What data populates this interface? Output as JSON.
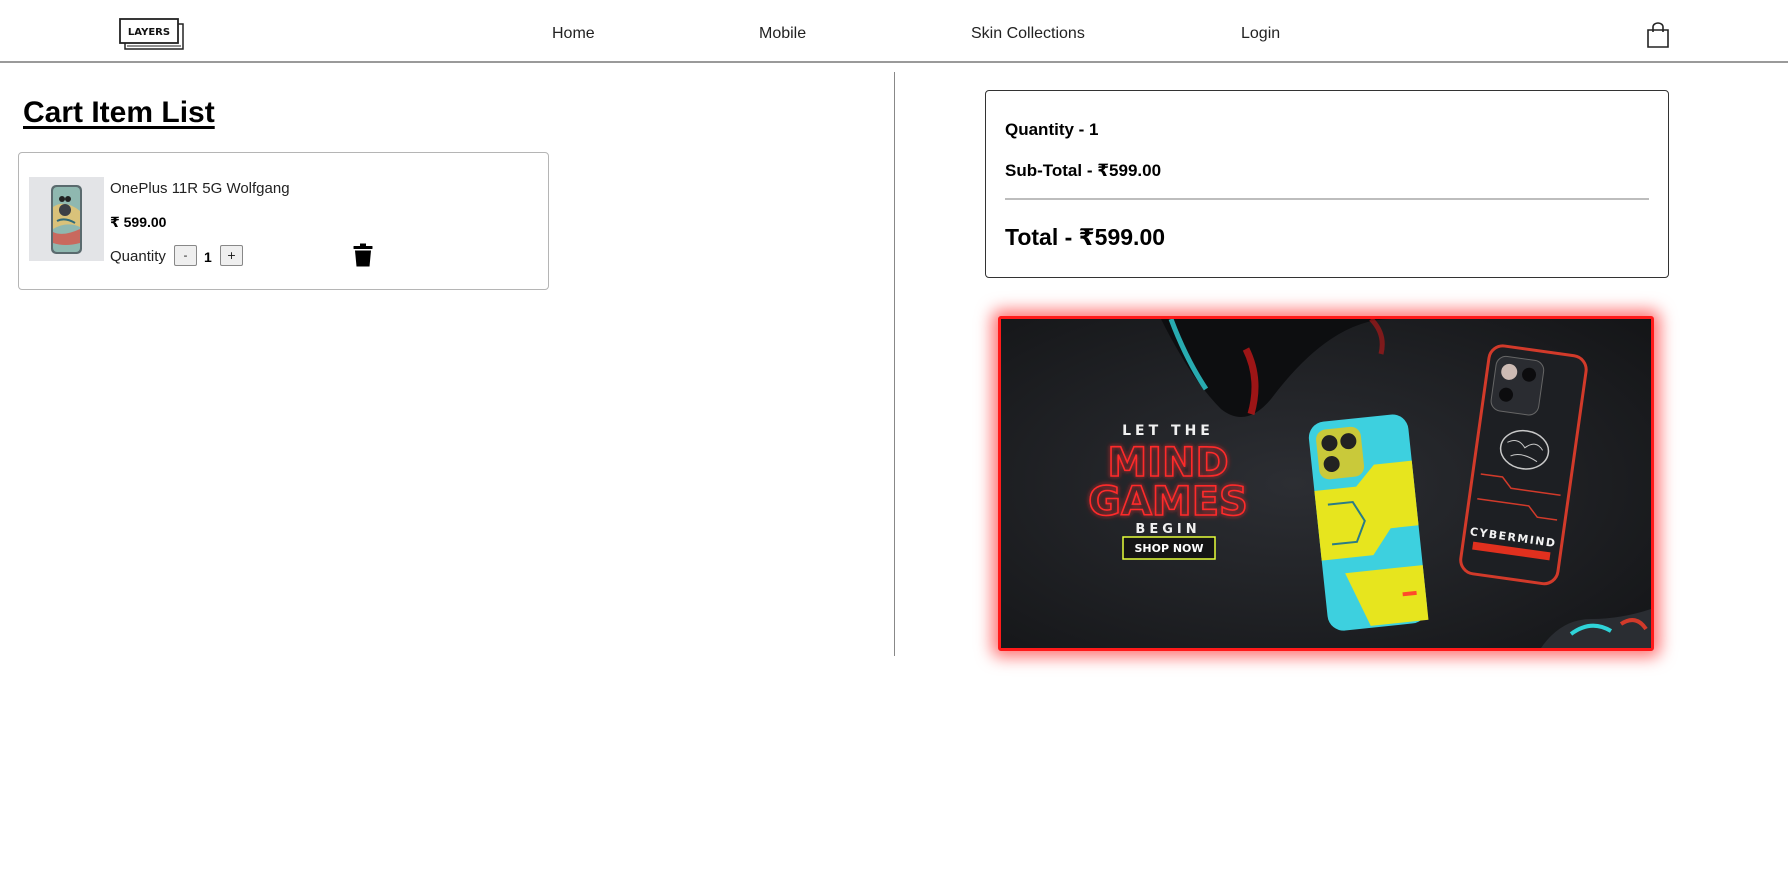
{
  "header": {
    "logo_text": "LAYERS",
    "nav": [
      {
        "label": "Home"
      },
      {
        "label": "Mobile"
      },
      {
        "label": "Skin Collections"
      },
      {
        "label": "Login"
      }
    ],
    "cart_icon": "shopping-bag-icon"
  },
  "cart": {
    "title": "Cart Item List",
    "items": [
      {
        "name": "OnePlus 11R 5G Wolfgang",
        "price": "₹ 599.00",
        "quantity_label": "Quantity",
        "decrement_label": "-",
        "increment_label": "+",
        "quantity": "1",
        "delete_icon": "trash-icon"
      }
    ]
  },
  "summary": {
    "quantity": "Quantity - 1",
    "subtotal": "Sub-Total - ₹599.00",
    "total": "Total - ₹599.00"
  },
  "banner": {
    "line1": "LET THE",
    "line2": "MIND",
    "line3": "GAMES",
    "line4": "BEGIN",
    "cta": "SHOP NOW",
    "phone_label": "CYBERMIND"
  },
  "colors": {
    "banner_border": "#ff1a1a",
    "banner_neon": "#ff2a2a",
    "banner_bg": "#1a1b1e"
  }
}
